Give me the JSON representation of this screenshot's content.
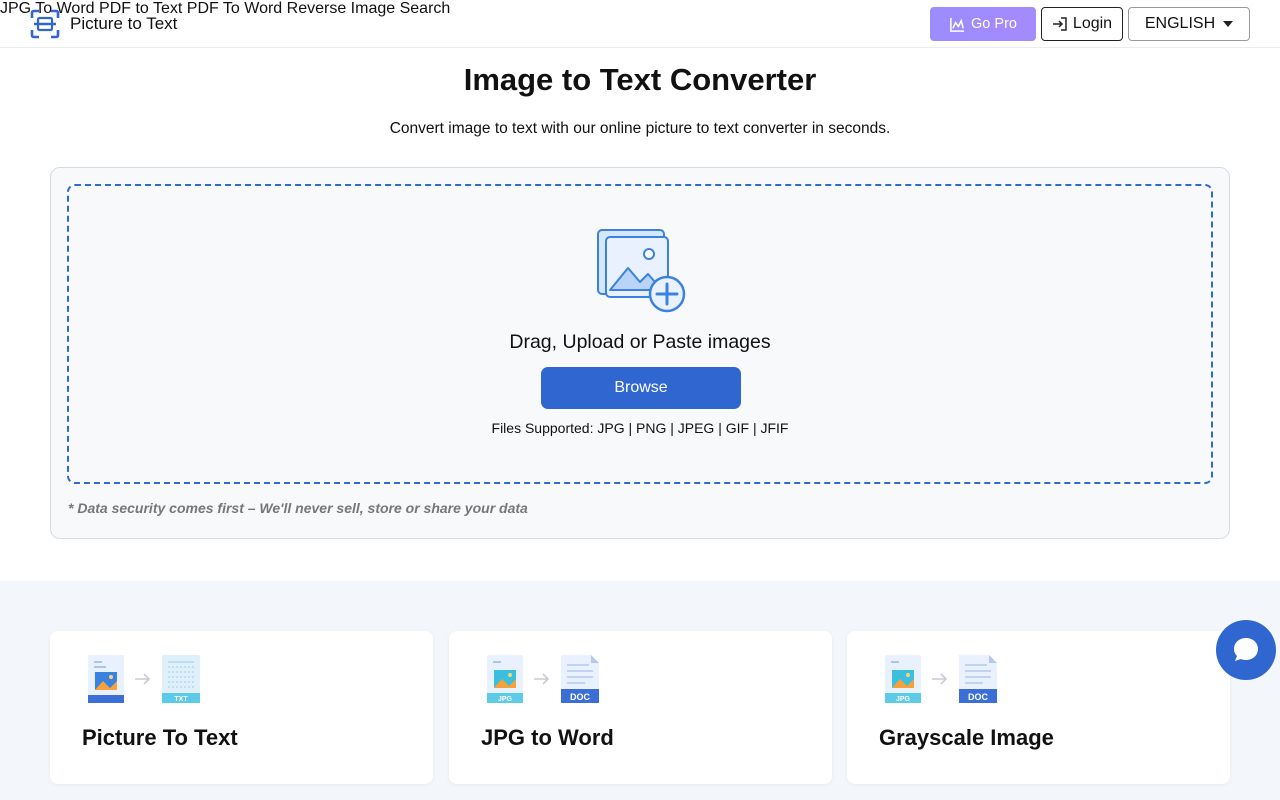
{
  "header": {
    "brand": "Picture to Text",
    "nav": [
      "JPG To Word",
      "PDF to Text",
      "PDF To Word",
      "Reverse Image Search"
    ],
    "go_pro": "Go Pro",
    "login": "Login",
    "language": "ENGLISH"
  },
  "hero": {
    "title": "Image to Text Converter",
    "subtitle": "Convert image to text with our online picture to text converter in seconds."
  },
  "upload": {
    "drag_text": "Drag, Upload or Paste images",
    "browse": "Browse",
    "files_supported": "Files Supported: JPG | PNG | JPEG | GIF | JFIF",
    "security": "* Data security comes first – We'll never sell, store or share your data"
  },
  "tools": [
    {
      "title": "Picture To Text",
      "badge": "TXT"
    },
    {
      "title": "JPG to Word",
      "from_badge": "JPG",
      "badge": "DOC"
    },
    {
      "title": "Grayscale Image",
      "from_badge": "JPG",
      "badge": "DOC"
    }
  ],
  "colors": {
    "accent": "#2f66cf",
    "go_pro": "#a38bfd",
    "dropzone_border": "#2f6ad0",
    "tools_bg": "#f3f6fb"
  }
}
